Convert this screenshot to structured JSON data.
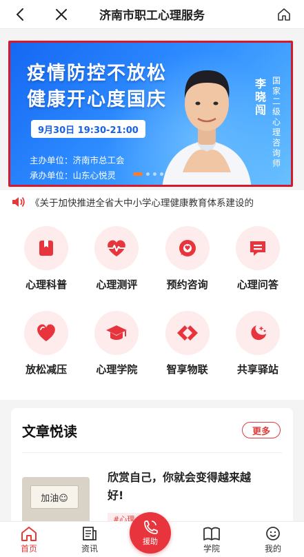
{
  "header": {
    "title": "济南市职工心理服务"
  },
  "banner": {
    "headline_1": "疫情防控不放松",
    "headline_2": "健康开心度国庆",
    "time": "9月30日 19:30-21:00",
    "organizer": "主办单位：济南市总工会",
    "co_organizer": "承办单位：山东心悦灵",
    "speaker_name": "李晓闯",
    "speaker_title": "国家二级心理咨询师",
    "slide_count": 4,
    "active_slide": 1
  },
  "notice": {
    "text": "《关于加快推进全省大中小学心理健康教育体系建设的"
  },
  "services": [
    {
      "label": "心理科普",
      "icon": "bookmark-icon"
    },
    {
      "label": "心理测评",
      "icon": "heartbeat-icon"
    },
    {
      "label": "预约咨询",
      "icon": "chat-bubble-icon"
    },
    {
      "label": "心理问答",
      "icon": "message-icon"
    },
    {
      "label": "放松减压",
      "icon": "heart-icon"
    },
    {
      "label": "心理学院",
      "icon": "graduation-cap-icon"
    },
    {
      "label": "智享物联",
      "icon": "link-icon"
    },
    {
      "label": "共享驿站",
      "icon": "moon-stars-icon"
    }
  ],
  "articles": {
    "section_title": "文章悦读",
    "more_label": "更多",
    "items": [
      {
        "title": "欣赏自己，你就会变得越来越好!",
        "thumb_text": "加油☺",
        "tag": "#心理"
      }
    ]
  },
  "bottom_nav": {
    "items": [
      {
        "label": "首页",
        "icon": "home-icon",
        "active": true
      },
      {
        "label": "资讯",
        "icon": "news-icon",
        "active": false
      },
      {
        "label": "援助",
        "icon": "phone-icon",
        "active": false
      },
      {
        "label": "学院",
        "icon": "book-icon",
        "active": false
      },
      {
        "label": "我的",
        "icon": "smile-icon",
        "active": false
      }
    ]
  },
  "colors": {
    "accent": "#e8343c",
    "banner_blue": "#1f74f5",
    "icon_bg": "#fdeceb"
  }
}
